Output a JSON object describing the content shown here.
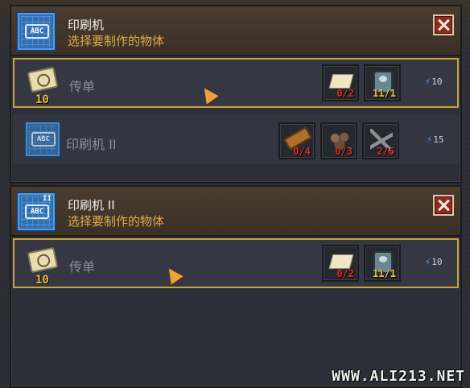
{
  "panels": [
    {
      "title": "印刷机",
      "subtitle": "选择要制作的物体",
      "blueprint_text": "ABC",
      "tier_mark": "",
      "recipes": [
        {
          "name": "传单",
          "quantity": "10",
          "selected": true,
          "energy": "10",
          "ingredients": [
            {
              "icon": "paper-stack-icon",
              "count": "0/2",
              "color": "#d83224"
            },
            {
              "icon": "printing-plate-icon",
              "count": "11/1",
              "color": "#f0c23c"
            }
          ]
        },
        {
          "name": "印刷机 II",
          "selected": false,
          "energy": "15",
          "ingredients": [
            {
              "icon": "wood-plank-icon",
              "count": "0/4",
              "color": "#d83224"
            },
            {
              "icon": "ore-icon",
              "count": "0/3",
              "color": "#d83224"
            },
            {
              "icon": "nails-icon",
              "count": "2/6",
              "color": "#d83224"
            }
          ]
        }
      ]
    },
    {
      "title": "印刷机 II",
      "subtitle": "选择要制作的物体",
      "blueprint_text": "ABC",
      "tier_mark": "II",
      "recipes": [
        {
          "name": "传单",
          "quantity": "10",
          "selected": true,
          "energy": "10",
          "ingredients": [
            {
              "icon": "paper-stack-icon",
              "count": "0/2",
              "color": "#d83224"
            },
            {
              "icon": "printing-plate-icon",
              "count": "11/1",
              "color": "#f0c23c"
            }
          ]
        }
      ]
    }
  ],
  "watermark": "WWW.ALI213.NET",
  "colors": {
    "accent_gold": "#c8a43c",
    "title": "#f2f0ea",
    "subtitle": "#e6a94a",
    "energy_bolt": "#4a9cf2"
  }
}
